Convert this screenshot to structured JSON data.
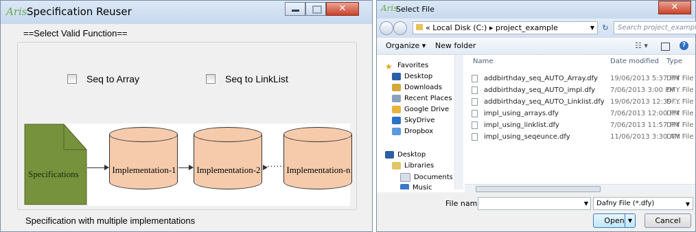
{
  "left_window": {
    "logo": "Aris",
    "title": "Specification Reuser",
    "group_title": "==Select Valid Function==",
    "checkboxes": [
      {
        "label": "Seq to Array",
        "checked": false
      },
      {
        "label": "Seq to LinkList",
        "checked": false
      }
    ],
    "diagram": {
      "spec_label": "Specifications",
      "implementations": [
        "Implementation-1",
        "Implementation-2",
        "Implementation-n"
      ],
      "ellipsis": "······"
    },
    "status_text": "Specification with multiple implementations",
    "colors": {
      "spec_fill": "#76923c",
      "impl_fill": "#f5cbac"
    }
  },
  "right_window": {
    "logo": "Aris",
    "title": "Select File",
    "address_path": "« Local Disk (C:) ▸ project_example",
    "search_placeholder": "Search project_example",
    "organize": "Organize ▾",
    "new_folder": "New folder",
    "nav_items": [
      {
        "label": "Favorites",
        "icon": "star-icon"
      },
      {
        "label": "Desktop",
        "icon": "desktop-icon"
      },
      {
        "label": "Downloads",
        "icon": "downloads-icon"
      },
      {
        "label": "Recent Places",
        "icon": "recent-places-icon"
      },
      {
        "label": "Google Drive",
        "icon": "google-drive-icon"
      },
      {
        "label": "SkyDrive",
        "icon": "skydrive-icon"
      },
      {
        "label": "Dropbox",
        "icon": "dropbox-icon"
      },
      {
        "label": "Desktop",
        "icon": "desktop-icon"
      },
      {
        "label": "Libraries",
        "icon": "libraries-icon"
      },
      {
        "label": "Documents",
        "icon": "documents-icon"
      },
      {
        "label": "Music",
        "icon": "music-icon"
      }
    ],
    "columns": {
      "name": "Name",
      "date": "Date modified",
      "type": "Type"
    },
    "files": [
      {
        "name": "addbirthday_seq_AUTO_Array.dfy",
        "date": "19/06/2013 5:37 PM",
        "type": "DFY File"
      },
      {
        "name": "addbirthday_seq_AUTO_impl.dfy",
        "date": "7/06/2013 3:00 PM",
        "type": "DFY File"
      },
      {
        "name": "addbirthday_seq_AUTO_Linklist.dfy",
        "date": "19/06/2013 12:39 ...",
        "type": "DFY File"
      },
      {
        "name": "impl_using_arrays.dfy",
        "date": "7/06/2013 12:00 PM",
        "type": "DFY File"
      },
      {
        "name": "impl_using_linklist.dfy",
        "date": "7/06/2013 11:57 PM",
        "type": "DFY File"
      },
      {
        "name": "impl_using_seqeunce.dfy",
        "date": "11/06/2013 3:30 AM",
        "type": "DFY File"
      }
    ],
    "file_name_label": "File name:",
    "file_name_value": "",
    "file_type": "Dafny File (*.dfy)",
    "open_button": "Open",
    "cancel_button": "Cancel"
  }
}
